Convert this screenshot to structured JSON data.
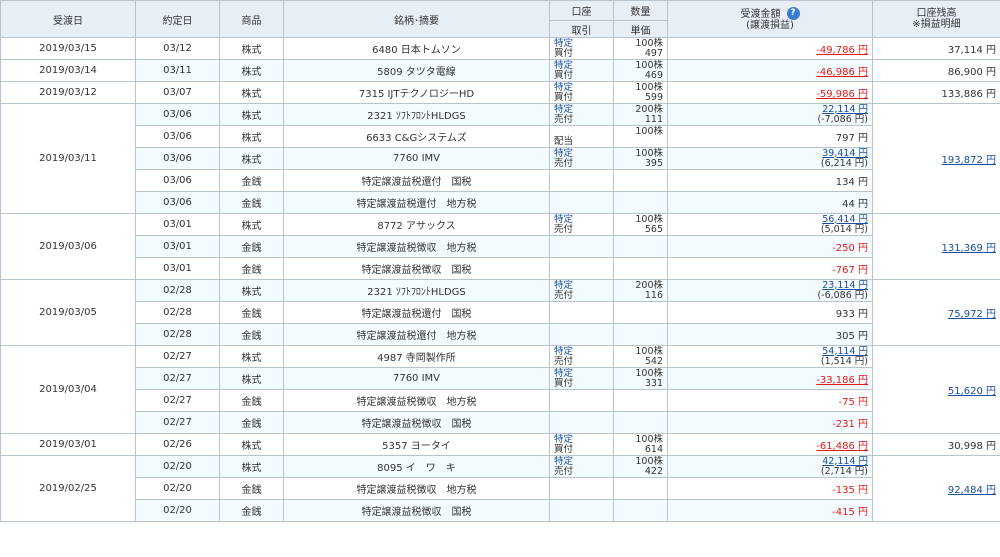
{
  "headers": {
    "settle_date": "受渡日",
    "trade_date": "約定日",
    "product": "商品",
    "description": "銘柄･摘要",
    "account": "口座",
    "trade": "取引",
    "quantity": "数量",
    "unit_price": "単価",
    "amount": "受渡金額",
    "amount_sub": "(譲渡損益)",
    "balance": "口座残高",
    "balance_sub": "※損益明細",
    "help_icon": "?"
  },
  "groups": [
    {
      "settle": "2019/03/15",
      "balance": "37,114 円",
      "balance_link": false,
      "rows": [
        {
          "trade_date": "03/12",
          "product": "株式",
          "description": "6480 日本トムソン",
          "account": "特定",
          "trade": "買付",
          "qty": "100株",
          "price": "497",
          "amount": "-49,786 円",
          "amount_red": true,
          "amount_link": true,
          "sub": ""
        }
      ]
    },
    {
      "settle": "2019/03/14",
      "balance": "86,900 円",
      "balance_link": false,
      "rows": [
        {
          "trade_date": "03/11",
          "product": "株式",
          "description": "5809 タツタ電線",
          "account": "特定",
          "trade": "買付",
          "qty": "100株",
          "price": "469",
          "amount": "-46,986 円",
          "amount_red": true,
          "amount_link": true,
          "sub": ""
        }
      ]
    },
    {
      "settle": "2019/03/12",
      "balance": "133,886 円",
      "balance_link": false,
      "rows": [
        {
          "trade_date": "03/07",
          "product": "株式",
          "description": "7315 IJTテクノロジーHD",
          "account": "特定",
          "trade": "買付",
          "qty": "100株",
          "price": "599",
          "amount": "-59,986 円",
          "amount_red": true,
          "amount_link": true,
          "sub": ""
        }
      ]
    },
    {
      "settle": "2019/03/11",
      "balance": "193,872 円",
      "balance_link": true,
      "rows": [
        {
          "trade_date": "03/06",
          "product": "株式",
          "description": "2321 ｿﾌﾄﾌﾛﾝﾄHLDGS",
          "account": "特定",
          "trade": "売付",
          "qty": "200株",
          "price": "111",
          "amount": "22,114 円",
          "amount_red": false,
          "amount_link": true,
          "sub": "(-7,086 円)"
        },
        {
          "trade_date": "03/06",
          "product": "株式",
          "description": "6633 C&Gシステムズ",
          "account": "",
          "trade": "配当",
          "qty": "100株",
          "price": "",
          "amount": "797 円",
          "amount_red": false,
          "amount_link": false,
          "sub": ""
        },
        {
          "trade_date": "03/06",
          "product": "株式",
          "description": "7760 IMV",
          "account": "特定",
          "trade": "売付",
          "qty": "100株",
          "price": "395",
          "amount": "39,414 円",
          "amount_red": false,
          "amount_link": true,
          "sub": "(6,214 円)"
        },
        {
          "trade_date": "03/06",
          "product": "金銭",
          "description": "特定譲渡益税還付　国税",
          "account": "",
          "trade": "",
          "qty": "",
          "price": "",
          "amount": "134 円",
          "amount_red": false,
          "amount_link": false,
          "sub": ""
        },
        {
          "trade_date": "03/06",
          "product": "金銭",
          "description": "特定譲渡益税還付　地方税",
          "account": "",
          "trade": "",
          "qty": "",
          "price": "",
          "amount": "44 円",
          "amount_red": false,
          "amount_link": false,
          "sub": ""
        }
      ]
    },
    {
      "settle": "2019/03/06",
      "balance": "131,369 円",
      "balance_link": true,
      "rows": [
        {
          "trade_date": "03/01",
          "product": "株式",
          "description": "8772 アサックス",
          "account": "特定",
          "trade": "売付",
          "qty": "100株",
          "price": "565",
          "amount": "56,414 円",
          "amount_red": false,
          "amount_link": true,
          "sub": "(5,014 円)"
        },
        {
          "trade_date": "03/01",
          "product": "金銭",
          "description": "特定譲渡益税徴収　地方税",
          "account": "",
          "trade": "",
          "qty": "",
          "price": "",
          "amount": "-250 円",
          "amount_red": true,
          "amount_link": false,
          "sub": ""
        },
        {
          "trade_date": "03/01",
          "product": "金銭",
          "description": "特定譲渡益税徴収　国税",
          "account": "",
          "trade": "",
          "qty": "",
          "price": "",
          "amount": "-767 円",
          "amount_red": true,
          "amount_link": false,
          "sub": ""
        }
      ]
    },
    {
      "settle": "2019/03/05",
      "balance": "75,972 円",
      "balance_link": true,
      "rows": [
        {
          "trade_date": "02/28",
          "product": "株式",
          "description": "2321 ｿﾌﾄﾌﾛﾝﾄHLDGS",
          "account": "特定",
          "trade": "売付",
          "qty": "200株",
          "price": "116",
          "amount": "23,114 円",
          "amount_red": false,
          "amount_link": true,
          "sub": "(-6,086 円)"
        },
        {
          "trade_date": "02/28",
          "product": "金銭",
          "description": "特定譲渡益税還付　国税",
          "account": "",
          "trade": "",
          "qty": "",
          "price": "",
          "amount": "933 円",
          "amount_red": false,
          "amount_link": false,
          "sub": ""
        },
        {
          "trade_date": "02/28",
          "product": "金銭",
          "description": "特定譲渡益税還付　地方税",
          "account": "",
          "trade": "",
          "qty": "",
          "price": "",
          "amount": "305 円",
          "amount_red": false,
          "amount_link": false,
          "sub": ""
        }
      ]
    },
    {
      "settle": "2019/03/04",
      "balance": "51,620 円",
      "balance_link": true,
      "rows": [
        {
          "trade_date": "02/27",
          "product": "株式",
          "description": "4987 寺岡製作所",
          "account": "特定",
          "trade": "売付",
          "qty": "100株",
          "price": "542",
          "amount": "54,114 円",
          "amount_red": false,
          "amount_link": true,
          "sub": "(1,514 円)"
        },
        {
          "trade_date": "02/27",
          "product": "株式",
          "description": "7760 IMV",
          "account": "特定",
          "trade": "買付",
          "qty": "100株",
          "price": "331",
          "amount": "-33,186 円",
          "amount_red": true,
          "amount_link": true,
          "sub": ""
        },
        {
          "trade_date": "02/27",
          "product": "金銭",
          "description": "特定譲渡益税徴収　地方税",
          "account": "",
          "trade": "",
          "qty": "",
          "price": "",
          "amount": "-75 円",
          "amount_red": true,
          "amount_link": false,
          "sub": ""
        },
        {
          "trade_date": "02/27",
          "product": "金銭",
          "description": "特定譲渡益税徴収　国税",
          "account": "",
          "trade": "",
          "qty": "",
          "price": "",
          "amount": "-231 円",
          "amount_red": true,
          "amount_link": false,
          "sub": ""
        }
      ]
    },
    {
      "settle": "2019/03/01",
      "balance": "30,998 円",
      "balance_link": false,
      "rows": [
        {
          "trade_date": "02/26",
          "product": "株式",
          "description": "5357 ヨータイ",
          "account": "特定",
          "trade": "買付",
          "qty": "100株",
          "price": "614",
          "amount": "-61,486 円",
          "amount_red": true,
          "amount_link": true,
          "sub": ""
        }
      ]
    },
    {
      "settle": "2019/02/25",
      "balance": "92,484 円",
      "balance_link": true,
      "rows": [
        {
          "trade_date": "02/20",
          "product": "株式",
          "description": "8095 イ　ワ　キ",
          "account": "特定",
          "trade": "売付",
          "qty": "100株",
          "price": "422",
          "amount": "42,114 円",
          "amount_red": false,
          "amount_link": true,
          "sub": "(2,714 円)"
        },
        {
          "trade_date": "02/20",
          "product": "金銭",
          "description": "特定譲渡益税徴収　地方税",
          "account": "",
          "trade": "",
          "qty": "",
          "price": "",
          "amount": "-135 円",
          "amount_red": true,
          "amount_link": false,
          "sub": ""
        },
        {
          "trade_date": "02/20",
          "product": "金銭",
          "description": "特定譲渡益税徴収　国税",
          "account": "",
          "trade": "",
          "qty": "",
          "price": "",
          "amount": "-415 円",
          "amount_red": true,
          "amount_link": false,
          "sub": ""
        }
      ]
    }
  ]
}
